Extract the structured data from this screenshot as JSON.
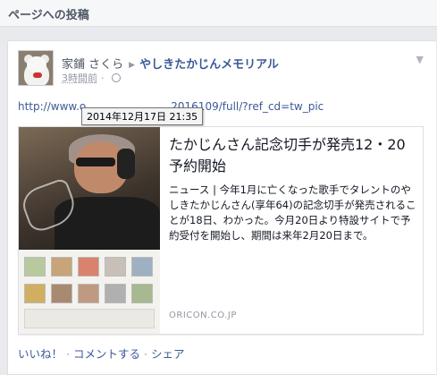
{
  "header": {
    "title": "ページへの投稿"
  },
  "post": {
    "author": "家鋪 さくら",
    "target_page": "やしきたかじんメモリアル",
    "time": "3時間前",
    "url": "http://www.o",
    "url_end": "2016109/full/?ref_cd=tw_pic",
    "tooltip": "2014年12月17日 21:35"
  },
  "attachment": {
    "title": "たかじんさん記念切手が発売12・20予約開始",
    "description": "ニュース | 今年1月に亡くなった歌手でタレントのやしきたかじんさん(享年64)の記念切手が発売されることが18日、わかった。今月20日より特設サイトで予約受付を開始し、期間は来年2月20日まで。",
    "domain": "ORICON.CO.JP"
  },
  "actions": {
    "like": "いいね！",
    "comment": "コメントする",
    "share": "シェア"
  },
  "colors": {
    "link": "#3b5998",
    "muted": "#9197a3",
    "background": "#e9eaed"
  },
  "icons": {
    "arrow": "triangle-right-icon",
    "globe": "globe-icon",
    "chevron": "chevron-down-icon"
  }
}
